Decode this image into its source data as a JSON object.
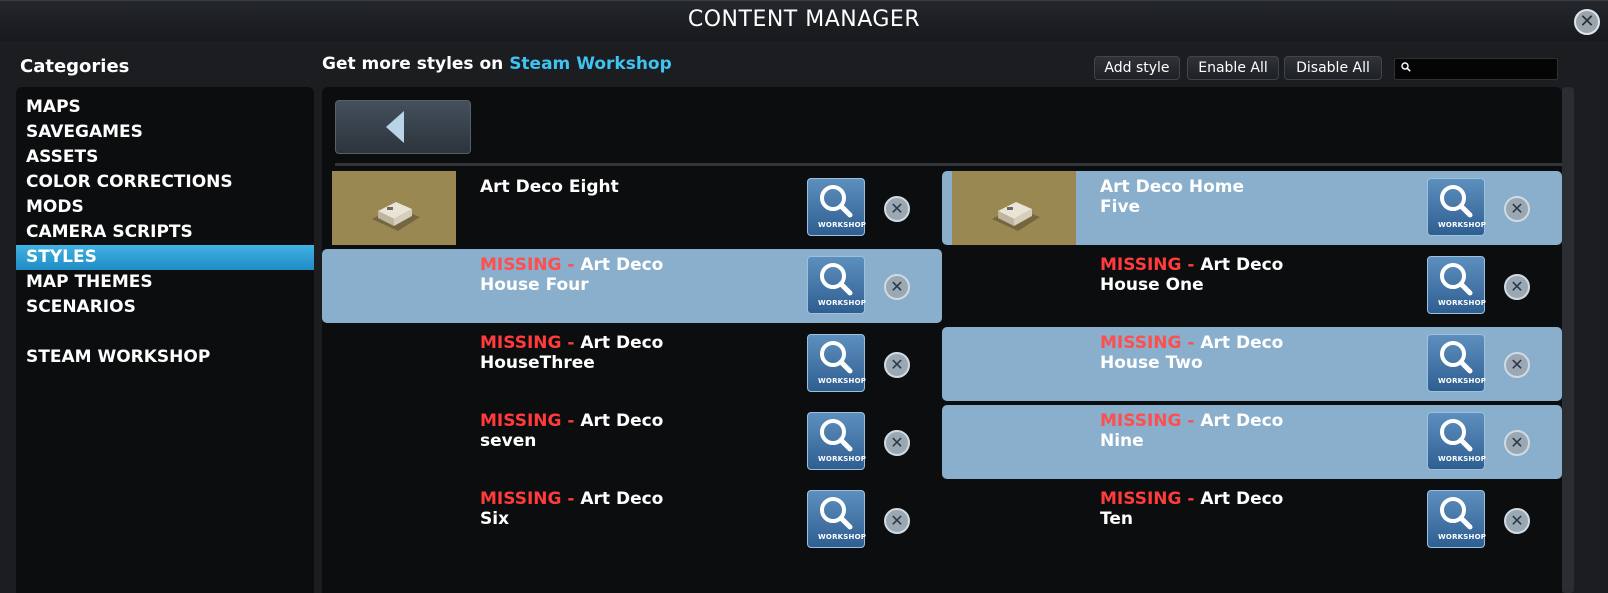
{
  "window": {
    "title": "CONTENT MANAGER",
    "close_symbol": "✕"
  },
  "sidebar": {
    "heading": "Categories",
    "items": [
      {
        "label": "MAPS",
        "selected": false
      },
      {
        "label": "SAVEGAMES",
        "selected": false
      },
      {
        "label": "ASSETS",
        "selected": false
      },
      {
        "label": "COLOR CORRECTIONS",
        "selected": false
      },
      {
        "label": "MODS",
        "selected": false
      },
      {
        "label": "CAMERA SCRIPTS",
        "selected": false
      },
      {
        "label": "STYLES",
        "selected": true
      },
      {
        "label": "MAP THEMES",
        "selected": false
      },
      {
        "label": "SCENARIOS",
        "selected": false
      },
      {
        "label": "STEAM WORKSHOP",
        "selected": false
      }
    ]
  },
  "toolbar": {
    "prefix": "Get more styles on ",
    "link": "Steam Workshop",
    "add_style": "Add style",
    "enable_all": "Enable All",
    "disable_all": "Disable All",
    "search_value": "",
    "search_icon": "search-icon"
  },
  "workshop_button": {
    "label": "WORKSHOP",
    "icon": "magnifier-icon"
  },
  "delete_symbol": "✕",
  "styles": [
    {
      "missing_prefix": "",
      "line1": "Art Deco Eight",
      "line2": "",
      "has_thumb": true,
      "selected": false
    },
    {
      "missing_prefix": "",
      "line1": "Art Deco Home",
      "line2": "Five",
      "has_thumb": true,
      "selected": true
    },
    {
      "missing_prefix": "MISSING - ",
      "line1": "Art Deco",
      "line2": "House Four",
      "has_thumb": false,
      "selected": true
    },
    {
      "missing_prefix": "MISSING - ",
      "line1": "Art Deco",
      "line2": "House One",
      "has_thumb": false,
      "selected": false
    },
    {
      "missing_prefix": "MISSING - ",
      "line1": "Art Deco",
      "line2": "HouseThree",
      "has_thumb": false,
      "selected": false
    },
    {
      "missing_prefix": "MISSING - ",
      "line1": "Art Deco",
      "line2": "House Two",
      "has_thumb": false,
      "selected": true
    },
    {
      "missing_prefix": "MISSING - ",
      "line1": "Art Deco",
      "line2": "seven",
      "has_thumb": false,
      "selected": false
    },
    {
      "missing_prefix": "MISSING - ",
      "line1": "Art Deco",
      "line2": "Nine",
      "has_thumb": false,
      "selected": true
    },
    {
      "missing_prefix": "MISSING - ",
      "line1": "Art Deco",
      "line2": "Six",
      "has_thumb": false,
      "selected": false
    },
    {
      "missing_prefix": "MISSING - ",
      "line1": "Art Deco",
      "line2": "Ten",
      "has_thumb": false,
      "selected": false
    }
  ],
  "colors": {
    "accent_blue": "#3fc3f1",
    "missing_red": "#ff3b3b",
    "selected_row": "#8aafcc",
    "sidebar_selected": "#2a9ed6"
  }
}
